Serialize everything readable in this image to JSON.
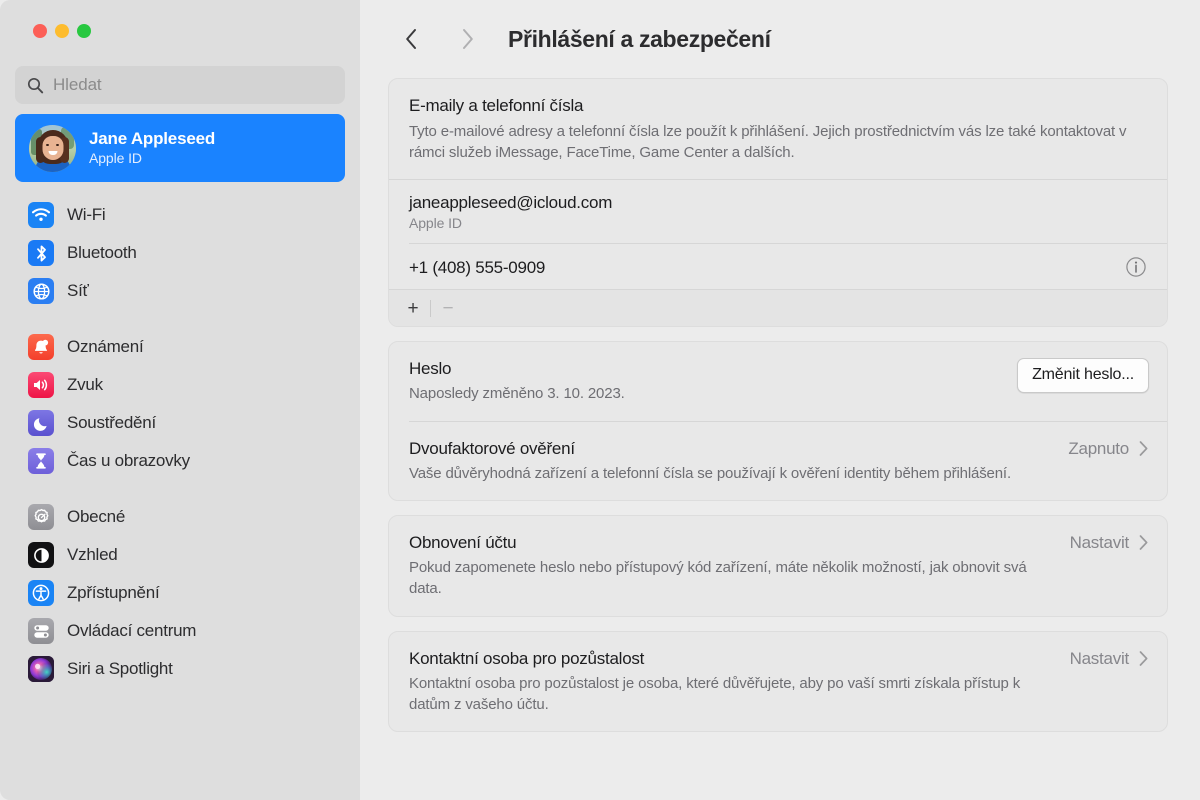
{
  "window": {
    "traffic_lights": [
      "close",
      "minimize",
      "zoom"
    ]
  },
  "sidebar": {
    "search": {
      "placeholder": "Hledat",
      "value": "",
      "icon": "search-icon"
    },
    "account": {
      "name": "Jane Appleseed",
      "subtitle": "Apple ID",
      "avatar": "user-avatar",
      "selected": true
    },
    "groups": [
      {
        "items": [
          {
            "label": "Wi-Fi",
            "icon": "wifi-icon",
            "color": "#1a84f5"
          },
          {
            "label": "Bluetooth",
            "icon": "bluetooth-icon",
            "color": "#1a7af5"
          },
          {
            "label": "Síť",
            "icon": "network-globe-icon",
            "color": "#2b7ef2"
          }
        ]
      },
      {
        "items": [
          {
            "label": "Oznámení",
            "icon": "bell-icon",
            "color": "#f7523f"
          },
          {
            "label": "Zvuk",
            "icon": "speaker-icon",
            "color": "#f42b5a"
          },
          {
            "label": "Soustředění",
            "icon": "moon-icon",
            "color": "#6a62d8"
          },
          {
            "label": "Čas u obrazovky",
            "icon": "hourglass-icon",
            "color": "#7a6ee0"
          }
        ]
      },
      {
        "items": [
          {
            "label": "Obecné",
            "icon": "gear-icon",
            "color": "#98989d"
          },
          {
            "label": "Vzhled",
            "icon": "appearance-icon",
            "color": "#1c1c1e"
          },
          {
            "label": "Zpřístupnění",
            "icon": "accessibility-icon",
            "color": "#1a84f5"
          },
          {
            "label": "Ovládací centrum",
            "icon": "control-center-icon",
            "color": "#98989d"
          },
          {
            "label": "Siri a Spotlight",
            "icon": "siri-icon",
            "color": "#3b2350"
          }
        ]
      }
    ]
  },
  "toolbar": {
    "back_icon": "chevron-left-icon",
    "forward_icon": "chevron-right-icon",
    "title": "Přihlášení a zabezpečení"
  },
  "main": {
    "emails_card": {
      "title": "E-maily a telefonní čísla",
      "description": "Tyto e-mailové adresy a telefonní čísla lze použít k přihlášení. Jejich prostřednictvím vás lze také kontaktovat v rámci služeb iMessage, FaceTime, Game Center a dalších.",
      "entries": [
        {
          "primary": "janeappleseed@icloud.com",
          "secondary": "Apple ID",
          "info": false
        },
        {
          "primary": "+1 (408) 555-0909",
          "secondary": "",
          "info": true
        }
      ],
      "add_label": "+",
      "remove_label": "−"
    },
    "security_card": {
      "password": {
        "title": "Heslo",
        "subtitle": "Naposledy změněno 3. 10. 2023.",
        "button_label": "Změnit heslo..."
      },
      "two_factor": {
        "title": "Dvoufaktorové ověření",
        "subtitle": "Vaše důvěryhodná zařízení a telefonní čísla se používají k ověření identity během přihlášení.",
        "value": "Zapnuto"
      }
    },
    "recovery_card": {
      "title": "Obnovení účtu",
      "subtitle": "Pokud zapomenete heslo nebo přístupový kód zařízení, máte několik možností, jak obnovit svá data.",
      "value": "Nastavit"
    },
    "legacy_card": {
      "title": "Kontaktní osoba pro pozůstalost",
      "subtitle": "Kontaktní osoba pro pozůstalost je osoba, které důvěřujete, aby po vaší smrti získala přístup k datům z vašeho účtu.",
      "value": "Nastavit"
    }
  }
}
